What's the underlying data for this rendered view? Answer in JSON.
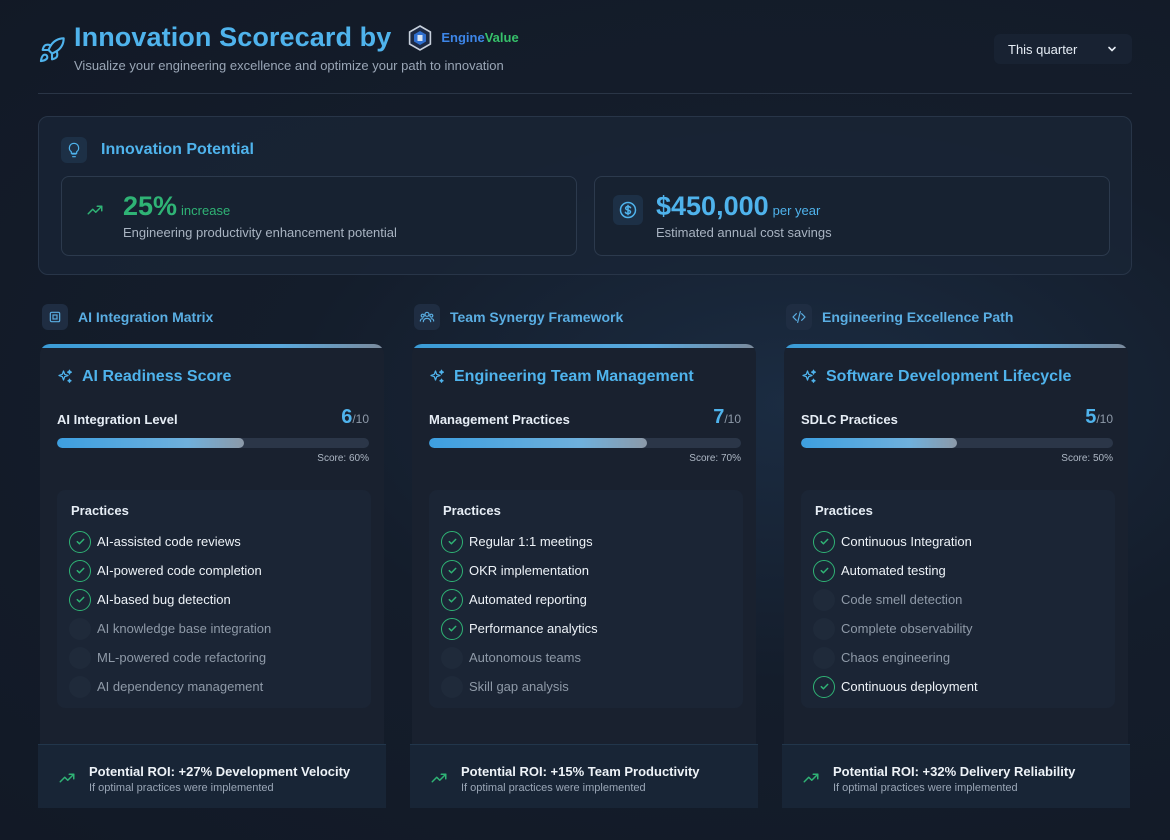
{
  "header": {
    "title": "Innovation Scorecard by",
    "brand_part1": "Engine",
    "brand_part2": "Value",
    "subtitle": "Visualize your engineering excellence and optimize your path to innovation",
    "period_select": "This quarter"
  },
  "potential": {
    "title": "Innovation Potential",
    "metrics": [
      {
        "value": "25%",
        "unit": "increase",
        "desc": "Engineering productivity enhancement potential"
      },
      {
        "value": "$450,000",
        "unit": "per year",
        "desc": "Estimated annual cost savings"
      }
    ]
  },
  "columns": [
    {
      "section": "AI Integration Matrix",
      "card_title": "AI Readiness Score",
      "level_label": "AI Integration Level",
      "score": "6",
      "max": "/10",
      "progress": 0.6,
      "score_text": "Score: 60%",
      "practices_title": "Practices",
      "practices": [
        {
          "label": "AI-assisted code reviews",
          "done": true
        },
        {
          "label": "AI-powered code completion",
          "done": true
        },
        {
          "label": "AI-based bug detection",
          "done": true
        },
        {
          "label": "AI knowledge base integration",
          "done": false
        },
        {
          "label": "ML-powered code refactoring",
          "done": false
        },
        {
          "label": "AI dependency management",
          "done": false
        }
      ],
      "roi_title": "Potential ROI: +27% Development Velocity",
      "roi_sub": "If optimal practices were implemented"
    },
    {
      "section": "Team Synergy Framework",
      "card_title": "Engineering Team Management",
      "level_label": "Management Practices",
      "score": "7",
      "max": "/10",
      "progress": 0.7,
      "score_text": "Score: 70%",
      "practices_title": "Practices",
      "practices": [
        {
          "label": "Regular 1:1 meetings",
          "done": true
        },
        {
          "label": "OKR implementation",
          "done": true
        },
        {
          "label": "Automated reporting",
          "done": true
        },
        {
          "label": "Performance analytics",
          "done": true
        },
        {
          "label": "Autonomous teams",
          "done": false
        },
        {
          "label": "Skill gap analysis",
          "done": false
        }
      ],
      "roi_title": "Potential ROI: +15% Team Productivity",
      "roi_sub": "If optimal practices were implemented"
    },
    {
      "section": "Engineering Excellence Path",
      "card_title": "Software Development Lifecycle",
      "level_label": "SDLC Practices",
      "score": "5",
      "max": "/10",
      "progress": 0.5,
      "score_text": "Score: 50%",
      "practices_title": "Practices",
      "practices": [
        {
          "label": "Continuous Integration",
          "done": true
        },
        {
          "label": "Automated testing",
          "done": true
        },
        {
          "label": "Code smell detection",
          "done": false
        },
        {
          "label": "Complete observability",
          "done": false
        },
        {
          "label": "Chaos engineering",
          "done": false
        },
        {
          "label": "Continuous deployment",
          "done": true
        }
      ],
      "roi_title": "Potential ROI: +32% Delivery Reliability",
      "roi_sub": "If optimal practices were implemented"
    }
  ],
  "colors": {
    "accent": "#4fb3ec",
    "success": "#2fb375",
    "background": "#141d2b"
  }
}
